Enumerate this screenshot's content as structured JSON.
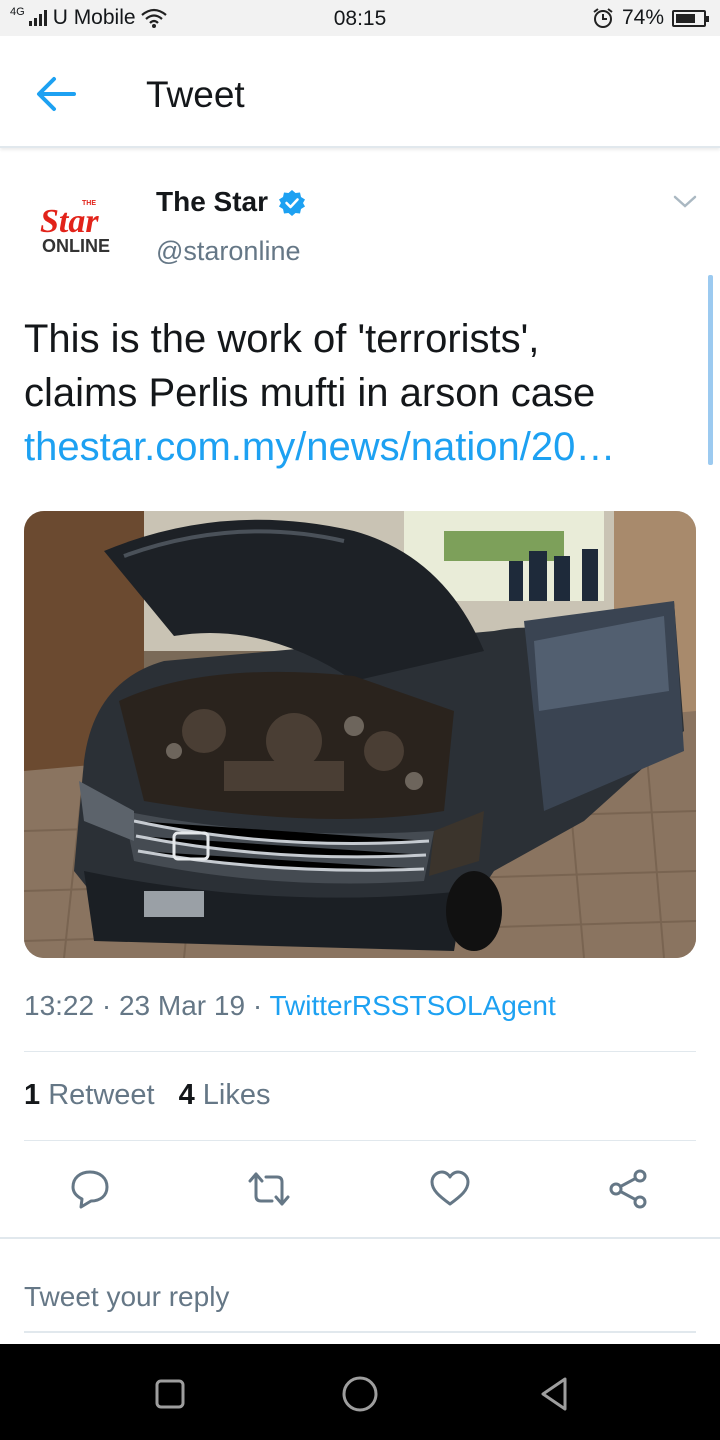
{
  "status_bar": {
    "network": "4G",
    "carrier": "U Mobile",
    "time": "08:15",
    "battery": "74%",
    "battery_level": 0.74
  },
  "app_bar": {
    "title": "Tweet",
    "back_icon": "arrow-left-icon"
  },
  "tweet": {
    "avatar_logo": {
      "top": "THE",
      "main": "Star",
      "sub": "ONLINE"
    },
    "author_name": "The Star",
    "handle": "@staronline",
    "text_line1": "This is the work of 'terrorists',",
    "text_line2": "claims Perlis mufti in arson case",
    "link": "thestar.com.my/news/nation/20…",
    "time": "13:22",
    "date": "23 Mar 19",
    "source": "TwitterRSSTSOLAgent",
    "retweets_count": "1",
    "retweets_label": "Retweet",
    "likes_count": "4",
    "likes_label": "Likes"
  },
  "actions": [
    {
      "icon": "reply-icon"
    },
    {
      "icon": "retweet-icon"
    },
    {
      "icon": "heart-icon"
    },
    {
      "icon": "share-icon"
    }
  ],
  "reply": {
    "placeholder": "Tweet your reply"
  },
  "colors": {
    "accent": "#1da1f2",
    "brand_red": "#e2231a",
    "secondary_text": "#657786",
    "divider": "#e1e8ed"
  }
}
